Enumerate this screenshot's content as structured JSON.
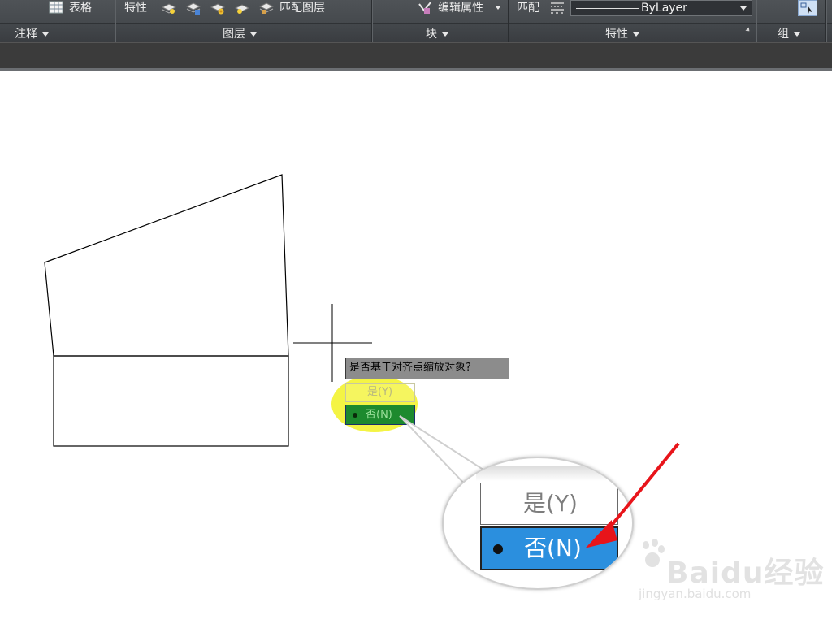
{
  "ribbon": {
    "annotate": {
      "table_label": "表格",
      "panel_title": "注释"
    },
    "layers": {
      "properties_label": "特性",
      "match_layer_label": "匹配图层",
      "panel_title": "图层"
    },
    "block": {
      "edit_attributes_label": "编辑属性",
      "panel_title": "块"
    },
    "properties": {
      "match_label": "匹配",
      "linetype_value": "ByLayer",
      "panel_title": "特性"
    },
    "groups": {
      "panel_title": "组"
    }
  },
  "prompt": {
    "question": "是否基于对齐点缩放对象?",
    "option_yes": "是(Y)",
    "option_no": "否(N)",
    "selected": "否(N)"
  },
  "callout": {
    "option_yes": "是(Y)",
    "option_no": "否(N)"
  },
  "watermark": {
    "brand": "Baidu经验",
    "url": "jingyan.baidu.com"
  },
  "colors": {
    "ribbon_bg": "#45494d",
    "highlight": "#f3f33a",
    "selected_green": "#1d8a2e",
    "selected_blue": "#2b8fde",
    "arrow_red": "#e8141a"
  }
}
